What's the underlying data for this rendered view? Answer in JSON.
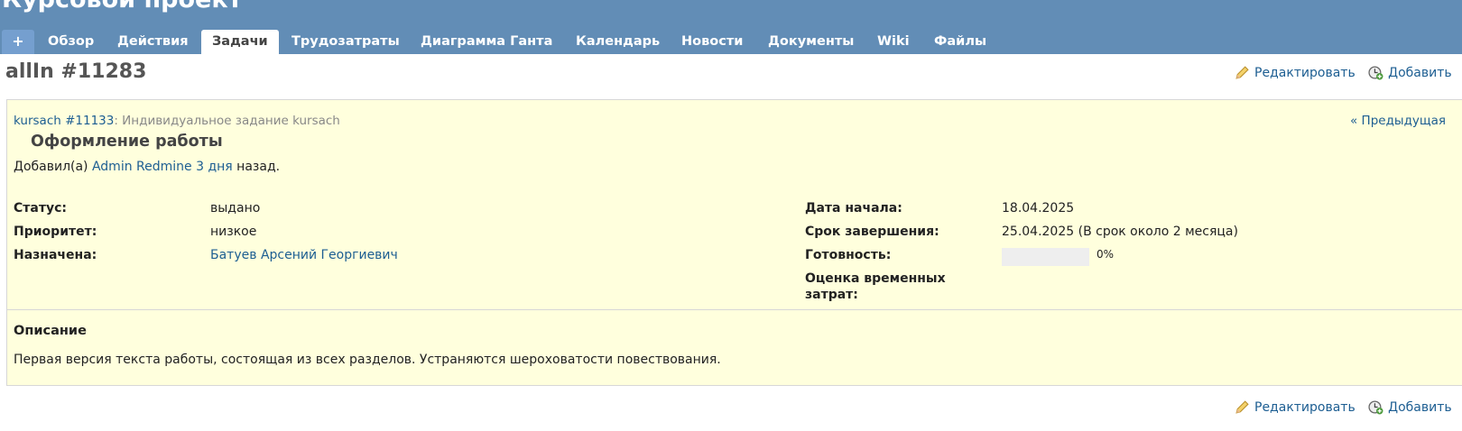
{
  "header": {
    "project_title": "Курсовой проект",
    "new_button": "+",
    "tabs": [
      {
        "label": "Обзор"
      },
      {
        "label": "Действия"
      },
      {
        "label": "Задачи"
      },
      {
        "label": "Трудозатраты"
      },
      {
        "label": "Диаграмма Ганта"
      },
      {
        "label": "Календарь"
      },
      {
        "label": "Новости"
      },
      {
        "label": "Документы"
      },
      {
        "label": "Wiki"
      },
      {
        "label": "Файлы"
      }
    ],
    "selected_tab": "Задачи"
  },
  "issue": {
    "title": "allIn #11283",
    "parent_link": "kursach #11133",
    "parent_suffix": ": Индивидуальное задание kursach",
    "prev_link": "« Предыдущая",
    "subject": "Оформление работы",
    "author_prefix": "Добавил(а) ",
    "author": "Admin Redmine",
    "age": "3 дня",
    "author_suffix": " назад.",
    "attributes": {
      "status_label": "Статус:",
      "status_value": "выдано",
      "priority_label": "Приоритет:",
      "priority_value": "низкое",
      "assignee_label": "Назначена:",
      "assignee_value": "Батуев Арсений Георгиевич",
      "start_label": "Дата начала:",
      "start_value": "18.04.2025",
      "due_label": "Срок завершения:",
      "due_value": "25.04.2025 (В срок около 2 месяца)",
      "done_label": "Готовность:",
      "done_ratio": 0,
      "done_text": "0%",
      "estimate_label_1": "Оценка временных",
      "estimate_label_2": "затрат:"
    },
    "description_heading": "Описание",
    "description_text": "Первая версия текста работы, состоящая из всех разделов. Устраняются шероховатости повествования."
  },
  "actions": {
    "edit": "Редактировать",
    "add": "Добавить"
  },
  "colors": {
    "header_bg": "#628db6",
    "issue_bg": "#ffffdd",
    "link": "#1d5e92"
  }
}
